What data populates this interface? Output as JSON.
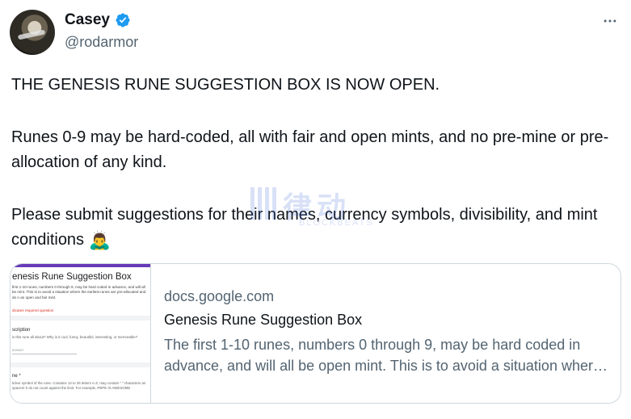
{
  "author": {
    "display_name": "Casey",
    "handle": "@rodarmor",
    "verified_icon": "verified-badge-icon",
    "verified_color": "#1d9bf0"
  },
  "more_icon": "more-horizontal-icon",
  "tweet": {
    "paragraph_1": "THE GENESIS RUNE SUGGESTION BOX IS NOW OPEN.",
    "paragraph_2": "Runes 0-9 may be hard-coded, all with fair and open mints, and no pre-mine or pre-allocation of any kind.",
    "paragraph_3": "Please submit suggestions for their names, currency symbols, divisibility, and mint conditions",
    "emoji": "🙇‍♂️"
  },
  "watermark": {
    "big": "律动",
    "small": "BLOCKBEATS"
  },
  "link_card": {
    "domain": "docs.google.com",
    "title": "Genesis Rune Suggestion Box",
    "description": "The first 1-10 runes, numbers 0 through 9, may be hard coded in advance, and will all be open mint. This is to avoid a situation where the earliest runes are pre-allocated and do not get an open and fair mint.",
    "thumbnail": {
      "form_title": "enesis Rune Suggestion Box",
      "form_description": "first 1-10 runes, numbers 0 through 9, may be hard coded in advance, and will all be mint. This is to avoid a situation where the earliest runes are pre-allocated and do n an open and fair mint.",
      "required_note": "dicates required question",
      "q1_label": "scription",
      "q1_desc": "is this rune all about? Why is it cool, funny, beautiful, interesting, or memorable?",
      "q1_placeholder": "answer",
      "q2_label": "ne *",
      "q2_desc": "ticker symbol of the rune. Contains 13 to 26 letters A-Z, may contain \".\" characters as spacers h do not count against the limit. For example, PEPE IS AWESOME"
    }
  }
}
